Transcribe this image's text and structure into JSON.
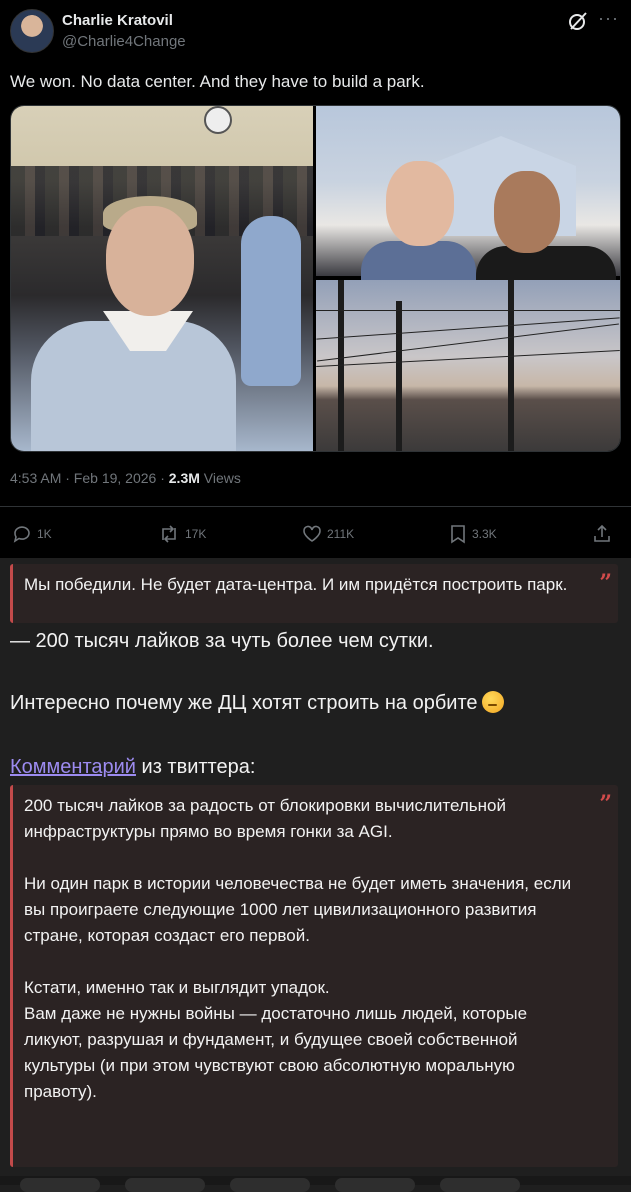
{
  "tweet": {
    "author_name": "Charlie Kratovil",
    "author_handle": "@Charlie4Change",
    "text": "We won.  No data center.  And they have to build a park.",
    "time": "4:53 AM · Feb 19, 2026 · ",
    "views_count": "2.3M",
    "views_label": " Views",
    "actions": {
      "replies": "1K",
      "retweets": "17K",
      "likes": "211K",
      "bookmarks": "3.3K"
    }
  },
  "post": {
    "quote1": "Мы победили. Не будет дата-центра. И им придётся построить парк.",
    "line1": "— 200 тысяч лайков за чуть более чем сутки.",
    "line2": "Интересно почему же ДЦ хотят строить на орбите",
    "comment_link": "Комментарий",
    "comment_suffix": " из твиттера:",
    "quote2": "200 тысяч лайков за радость от блокировки вычислительной инфраструктуры прямо во время гонки за AGI.\n\nНи один парк в истории человечества не будет иметь значения, если вы проиграете следующие 1000 лет цивилизационного развития стране, которая создаст его первой.\n\nКстати, именно так и выглядит упадок.\nВам даже не нужны войны — достаточно лишь людей, которые ликуют, разрушая и фундамент, и будущее своей собственной культуры (и при этом чувствуют свою абсолютную моральную правоту).",
    "quote_mark": "”"
  },
  "colors": {
    "tweet_bg": "#000000",
    "chat_bg": "#1f1f1f",
    "quote_bg": "#2b2323",
    "quote_bar": "#c24a4a",
    "link": "#9c8bf0"
  },
  "icons": [
    "avatar",
    "grok-icon",
    "more-icon",
    "reply-icon",
    "retweet-icon",
    "like-icon",
    "bookmark-icon",
    "share-icon",
    "quote-icon",
    "thinking-emoji"
  ]
}
